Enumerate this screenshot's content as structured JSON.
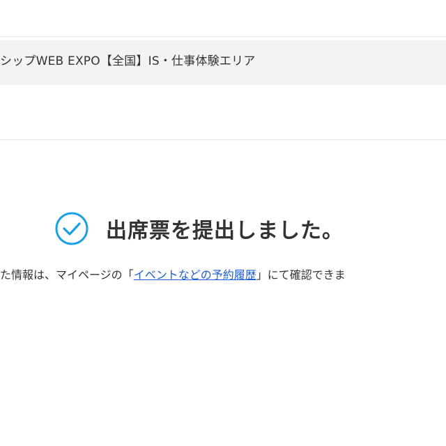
{
  "event": {
    "title": "シップWEB EXPO【全国】IS・仕事体験エリア"
  },
  "confirmation": {
    "heading": "出席票を提出しました。",
    "icon": "check-circle-icon",
    "icon_color": "#1ba1e2"
  },
  "info": {
    "text_before": "た情報は、マイページの「",
    "link_label": "イベントなどの予約履歴",
    "text_after": "」にて確認できま",
    "link_color": "#1a5fd6"
  }
}
